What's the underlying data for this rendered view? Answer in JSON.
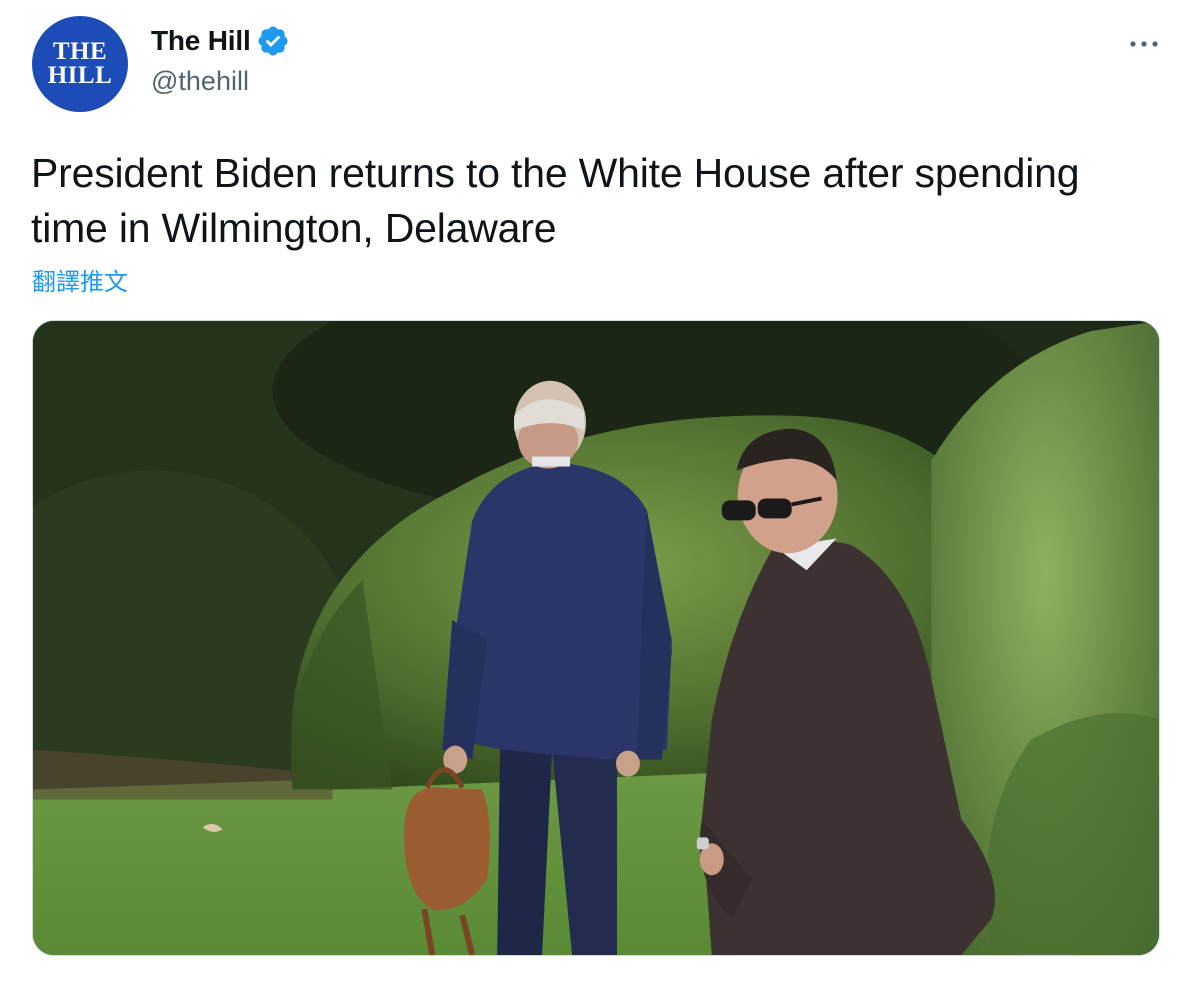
{
  "account": {
    "avatar_text_line1": "THE",
    "avatar_text_line2": "HILL",
    "display_name": "The Hill",
    "handle": "@thehill",
    "verified_icon": "verified-badge-icon"
  },
  "tweet": {
    "text": "President Biden returns to the White House after spending time in Wilmington, Delaware",
    "translate_label": "翻譯推文"
  },
  "media": {
    "type": "video-still",
    "description_icon": "photo"
  },
  "menu": {
    "icon": "more-horizontal-icon"
  },
  "colors": {
    "brand_blue": "#1d9bf0",
    "avatar_blue": "#1d4bb8",
    "text_primary": "#0f1419",
    "text_secondary": "#536471"
  }
}
